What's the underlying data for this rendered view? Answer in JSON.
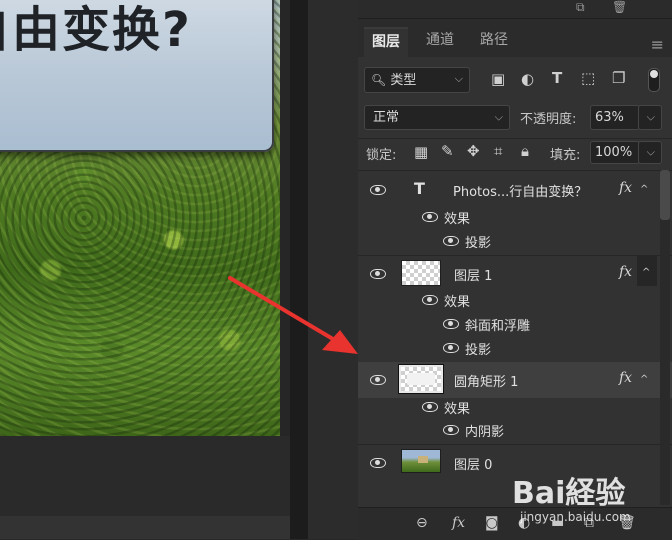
{
  "canvas": {
    "title_text": "自由变换?"
  },
  "panel": {
    "tabs": [
      {
        "label": "图层",
        "active": true
      },
      {
        "label": "通道",
        "active": false
      },
      {
        "label": "路径",
        "active": false
      }
    ],
    "filter": {
      "label": "类型"
    },
    "blend_mode": "正常",
    "opacity_label": "不透明度:",
    "opacity_value": "63%",
    "lock_label": "锁定:",
    "fill_label": "填充:",
    "fill_value": "100%",
    "layers": [
      {
        "name": "Photos...行自由变换？",
        "kind": "text",
        "fx": "fx",
        "effects_label": "效果",
        "effects": [
          "投影"
        ]
      },
      {
        "name": "图层 1",
        "kind": "pixel",
        "fx": "fx",
        "effects_label": "效果",
        "effects": [
          "斜面和浮雕",
          "投影"
        ]
      },
      {
        "name": "圆角矩形 1",
        "kind": "shape",
        "fx": "fx",
        "selected": true,
        "effects_label": "效果",
        "effects": [
          "内阴影"
        ]
      },
      {
        "name": "图层 0",
        "kind": "image"
      }
    ]
  },
  "watermark": {
    "logo": "Bai経验",
    "sub": "jingyan.baidu.com"
  },
  "colors": {
    "arrow": "#e8332e",
    "panel_bg": "#323232",
    "selected_row": "#3f3f3f"
  }
}
